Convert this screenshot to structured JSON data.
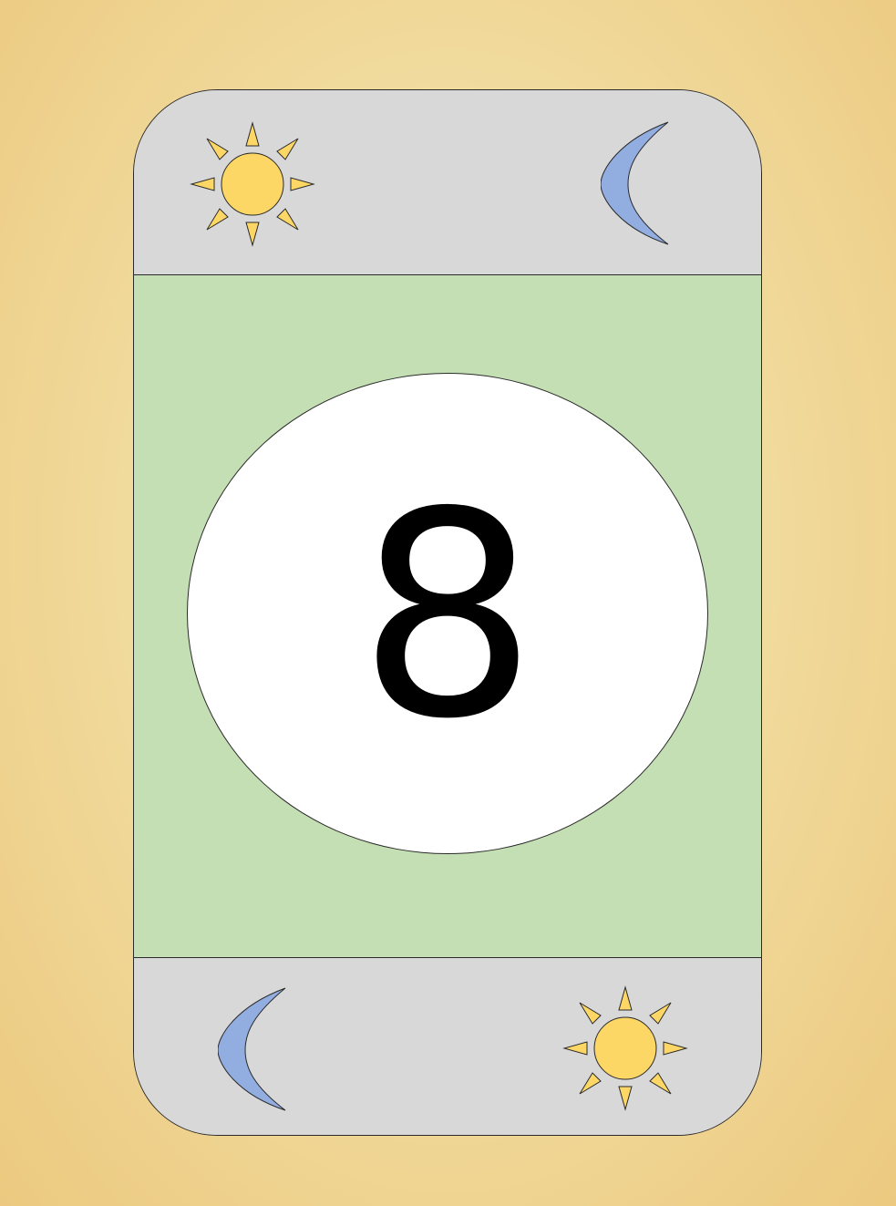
{
  "card": {
    "rank": "8",
    "colors": {
      "band": "#d8d8d8",
      "center": "#c5dfb5",
      "oval": "#ffffff",
      "sun": "#fdd766",
      "moon": "#92ade0"
    },
    "top_band": {
      "icons": [
        "sun-icon",
        "moon-icon"
      ]
    },
    "bottom_band": {
      "icons": [
        "moon-icon",
        "sun-icon"
      ]
    }
  }
}
